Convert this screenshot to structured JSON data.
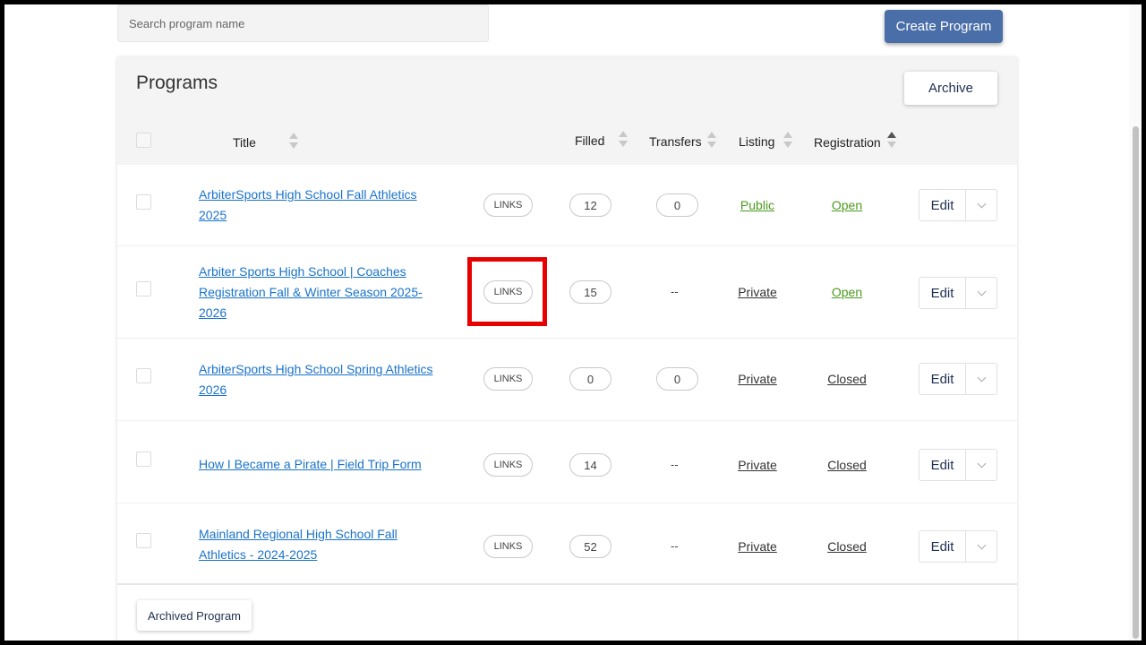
{
  "search": {
    "placeholder": "Search program name"
  },
  "header": {
    "create_label": "Create Program"
  },
  "panel": {
    "title": "Programs",
    "archive_label": "Archive",
    "columns": {
      "title": "Title",
      "filled": "Filled",
      "transfers": "Transfers",
      "listing": "Listing",
      "registration": "Registration"
    }
  },
  "rows": [
    {
      "title": "ArbiterSports High School Fall Athletics 2025",
      "links": "LINKS",
      "filled": "12",
      "transfers": "0",
      "listing": "Public",
      "registration": "Open",
      "edit": "Edit"
    },
    {
      "title": "Arbiter Sports High School | Coaches Registration Fall & Winter Season 2025-2026",
      "links": "LINKS",
      "filled": "15",
      "transfers": "--",
      "listing": "Private",
      "registration": "Open",
      "edit": "Edit"
    },
    {
      "title": "ArbiterSports High School Spring Athletics 2026",
      "links": "LINKS",
      "filled": "0",
      "transfers": "0",
      "listing": "Private",
      "registration": "Closed",
      "edit": "Edit"
    },
    {
      "title": "How I Became a Pirate | Field Trip Form",
      "links": "LINKS",
      "filled": "14",
      "transfers": "--",
      "listing": "Private",
      "registration": "Closed",
      "edit": "Edit"
    },
    {
      "title": "Mainland Regional High School Fall Athletics - 2024-2025",
      "links": "LINKS",
      "filled": "52",
      "transfers": "--",
      "listing": "Private",
      "registration": "Closed",
      "edit": "Edit"
    }
  ],
  "footer": {
    "archived_label": "Archived Program"
  },
  "colors": {
    "primary_button": "#4a6ea8",
    "link": "#1a73c9",
    "open_status": "#4a9a1e",
    "highlight": "#e60000"
  }
}
